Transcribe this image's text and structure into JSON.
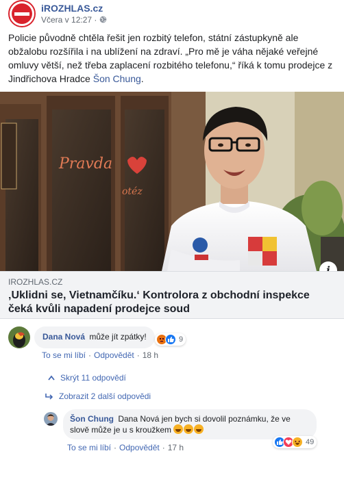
{
  "post": {
    "page_name": "iROZHLAS.cz",
    "timestamp": "Včera v 12:27 ·",
    "text_main": "Policie původně chtěla řešit jen rozbitý telefon, státní zástupkyně ale obžalobu rozšířila i na ublížení na zdraví. „Pro mě je váha nějaké veřejné omluvy větší, než třeba zaplacení rozbitého telefonu,“ říká k tomu prodejce z Jindřichova Hradce ",
    "text_mention": "Šon Chung",
    "text_end": "."
  },
  "link_card": {
    "domain": "IROZHLAS.CZ",
    "title": "‚Uklidni se, Vietnamčíku.‘ Kontrolora z obchodní inspekce čeká kvůli napadení prodejce soud"
  },
  "media": {
    "info_icon": "i",
    "sign_text": "Pravda",
    "storefront_text": "Pravda"
  },
  "comment1": {
    "author": "Dana Nová",
    "text": "může jít zpátky!",
    "reaction_count": "9",
    "like_label": "To se mi líbí",
    "reply_label": "Odpovědět",
    "age": "18 h"
  },
  "replies": {
    "hide_label": "Skrýt 11 odpovědí",
    "show_more_label": "Zobrazit 2 další odpovědi"
  },
  "comment2": {
    "author": "Šon Chung",
    "text": "Dana Nová jen bych si dovolil poznámku, že ve slově může je u s kroužkem",
    "reaction_count": "49",
    "like_label": "To se mi líbí",
    "reply_label": "Odpovědět",
    "age": "17 h"
  },
  "colors": {
    "link": "#385898",
    "action": "#4267b2",
    "brand_red": "#d9232d"
  },
  "icons": [
    "globe-icon",
    "info-icon",
    "reply-arrow-icon",
    "chevron-up-icon",
    "like-reaction-icon",
    "love-reaction-icon",
    "haha-reaction-icon",
    "angry-reaction-icon"
  ]
}
